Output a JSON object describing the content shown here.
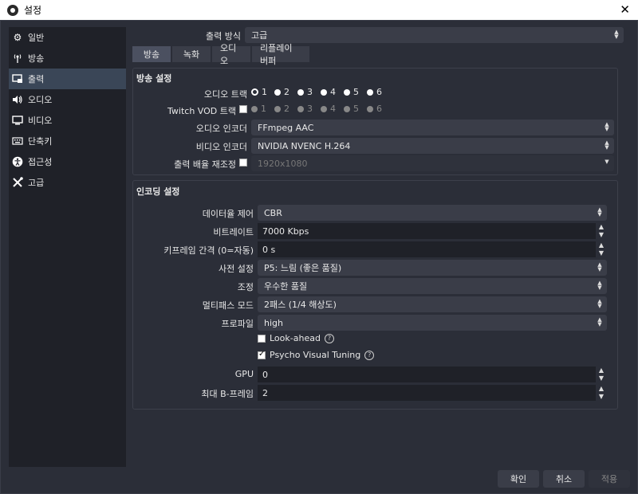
{
  "window": {
    "title": "설정"
  },
  "sidebar": {
    "items": [
      {
        "label": "일반",
        "icon": "gear-icon"
      },
      {
        "label": "방송",
        "icon": "antenna-icon"
      },
      {
        "label": "출력",
        "icon": "output-icon"
      },
      {
        "label": "오디오",
        "icon": "speaker-icon"
      },
      {
        "label": "비디오",
        "icon": "monitor-icon"
      },
      {
        "label": "단축키",
        "icon": "keyboard-icon"
      },
      {
        "label": "접근성",
        "icon": "accessibility-icon"
      },
      {
        "label": "고급",
        "icon": "tools-icon"
      }
    ],
    "active_index": 2
  },
  "output_mode": {
    "label": "출력 방식",
    "value": "고급"
  },
  "tabs": [
    {
      "label": "방송"
    },
    {
      "label": "녹화"
    },
    {
      "label": "오디오"
    },
    {
      "label": "리플레이 버퍼"
    }
  ],
  "streaming_settings": {
    "title": "방송 설정",
    "audio_track": {
      "label": "오디오 트랙",
      "options": [
        "1",
        "2",
        "3",
        "4",
        "5",
        "6"
      ],
      "selected": "1"
    },
    "twitch_vod": {
      "label": "Twitch VOD 트랙",
      "options": [
        "1",
        "2",
        "3",
        "4",
        "5",
        "6"
      ],
      "selected": "2"
    },
    "audio_encoder": {
      "label": "오디오 인코더",
      "value": "FFmpeg AAC"
    },
    "video_encoder": {
      "label": "비디오 인코더",
      "value": "NVIDIA NVENC H.264"
    },
    "rescale": {
      "label": "출력 배율 재조정",
      "value": "1920x1080"
    }
  },
  "encoding_settings": {
    "title": "인코딩 설정",
    "rate_control": {
      "label": "데이터율 제어",
      "value": "CBR"
    },
    "bitrate": {
      "label": "비트레이트",
      "value": "7000 Kbps"
    },
    "keyframe": {
      "label": "키프레임 간격 (0=자동)",
      "value": "0 s"
    },
    "preset": {
      "label": "사전 설정",
      "value": "P5: 느림 (좋은 품질)"
    },
    "tuning": {
      "label": "조정",
      "value": "우수한 품질"
    },
    "multipass": {
      "label": "멀티패스 모드",
      "value": "2패스 (1/4 해상도)"
    },
    "profile": {
      "label": "프로파일",
      "value": "high"
    },
    "lookahead": {
      "label": "Look-ahead",
      "checked": false
    },
    "psycho": {
      "label": "Psycho Visual Tuning",
      "checked": true
    },
    "gpu": {
      "label": "GPU",
      "value": "0"
    },
    "bframes": {
      "label": "최대 B-프레임",
      "value": "2"
    }
  },
  "footer": {
    "ok": "확인",
    "cancel": "취소",
    "apply": "적용"
  }
}
